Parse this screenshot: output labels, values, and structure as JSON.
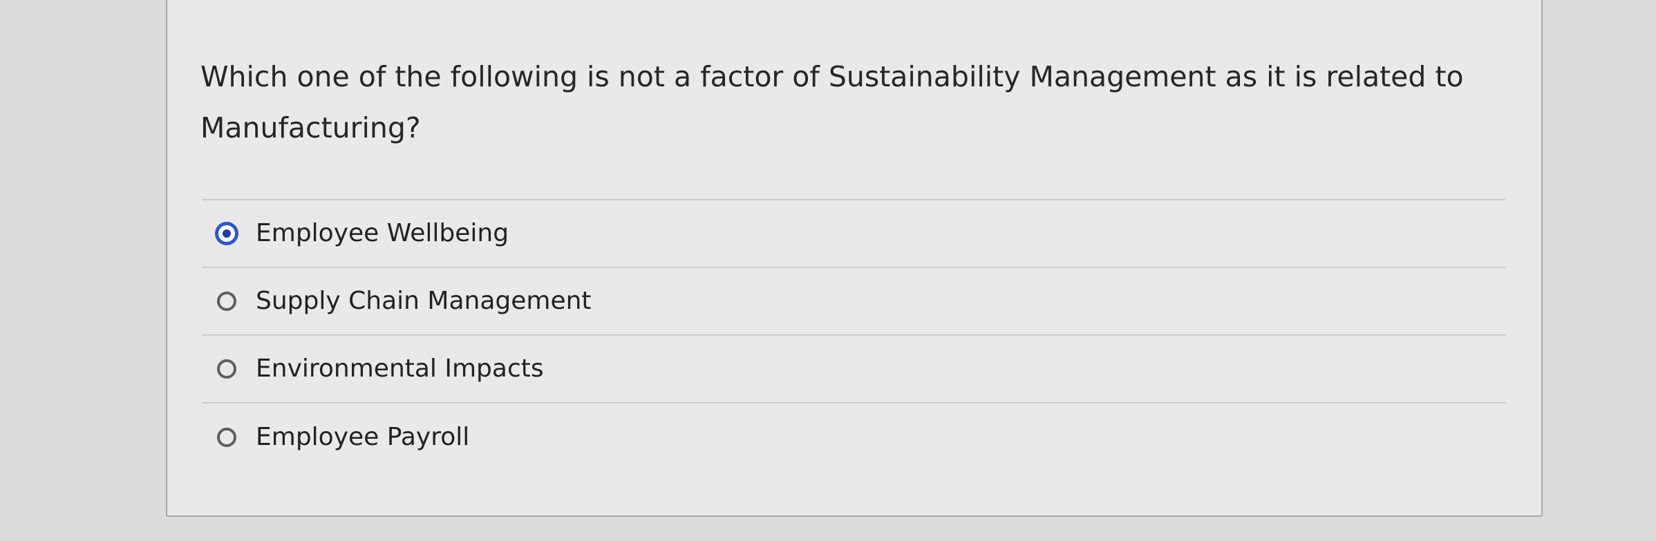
{
  "question": {
    "text": "Which one of the following is not a factor of Sustainability Management as it is related to Manufacturing?"
  },
  "answers": [
    {
      "label": "Employee Wellbeing",
      "selected": true
    },
    {
      "label": "Supply Chain Management",
      "selected": false
    },
    {
      "label": "Environmental Impacts",
      "selected": false
    },
    {
      "label": "Employee Payroll",
      "selected": false
    }
  ],
  "colors": {
    "selected_radio": "#2f58c8",
    "unselected_radio": "#5f5f5f"
  }
}
